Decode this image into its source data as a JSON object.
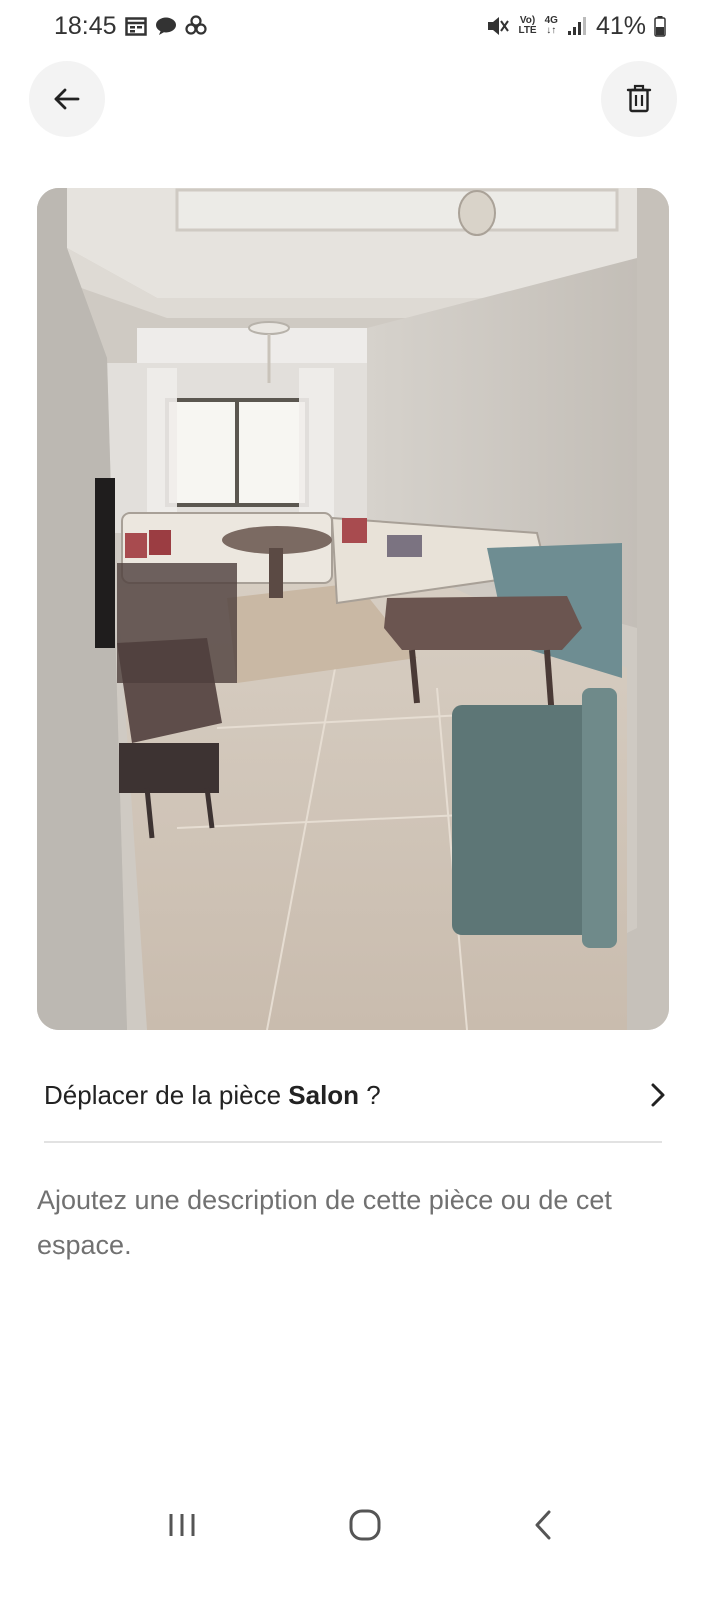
{
  "status_bar": {
    "time": "18:45",
    "left_icons": [
      "calendar-icon",
      "chat-bubble-icon",
      "pinwheel-icon"
    ],
    "volte_top": "Vo)",
    "volte_bottom": "LTE",
    "network_top": "4G",
    "network_bottom": "↓↑",
    "battery": "41%"
  },
  "header": {
    "back_icon": "arrow-left-icon",
    "delete_icon": "trash-icon"
  },
  "photo": {
    "subject": "living-room-photo"
  },
  "move_room": {
    "prefix": "Déplacer de la pièce ",
    "room": "Salon",
    "suffix": " ?",
    "chevron_icon": "chevron-right-icon"
  },
  "description": {
    "placeholder": "Ajoutez une description de cette pièce ou de cet espace."
  },
  "navigation": {
    "recents_icon": "recents-icon",
    "home_icon": "home-icon",
    "back_icon": "back-chevron-icon"
  },
  "colors": {
    "button_bg": "#f3f3f3",
    "text_primary": "#222222",
    "text_secondary": "#717171",
    "divider": "#e2e2e2"
  }
}
